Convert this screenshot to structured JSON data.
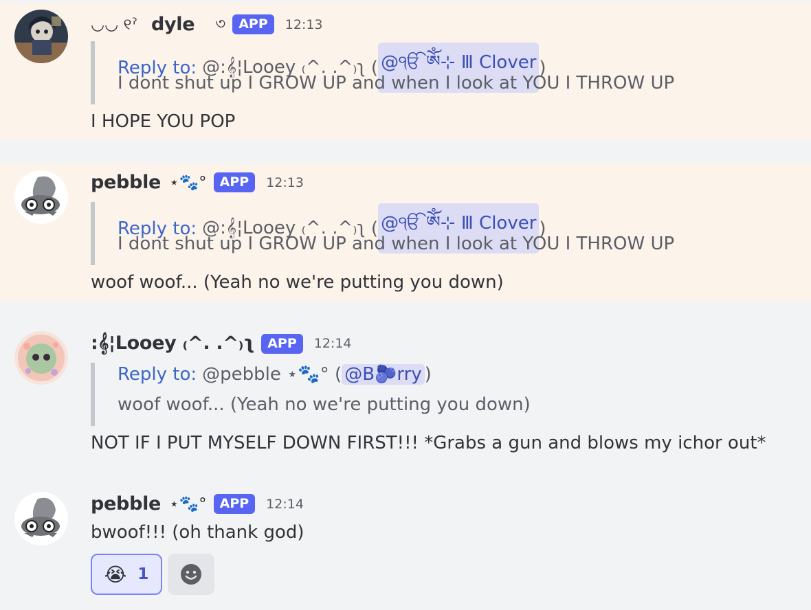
{
  "messages": [
    {
      "username": "dyle",
      "prefix_deco": "◡◡   ୧ˀ",
      "suffix_deco": "৩",
      "badge": "APP",
      "time": "12:13",
      "reply_label": "Reply to:",
      "reply_author": "@:𝄞¦Looey ₍^. .^₎ʅ",
      "reply_ping": "@ੴ ༀ⊹        Ⅲ        Clover",
      "reply_text": "I dont shut up I GROW UP and when I look at YOU I THROW UP",
      "text": "I HOPE YOU POP"
    },
    {
      "username": "pebble",
      "suffix_deco": "⋆🐾°",
      "badge": "APP",
      "time": "12:13",
      "reply_label": "Reply to:",
      "reply_author": "@:𝄞¦Looey ₍^. .^₎ʅ",
      "reply_ping": "@ੴ ༀ⊹        Ⅲ        Clover",
      "reply_text": "I dont shut up I GROW UP and when I look at YOU I THROW UP",
      "text": "woof woof... (Yeah no we're putting you down)"
    },
    {
      "username": ":𝄞¦Looey ₍^. .^₎ʅ",
      "badge": "APP",
      "time": "12:14",
      "reply_label": "Reply to:",
      "reply_author": "@pebble ⋆🐾°",
      "reply_ping": "@B🫐rry",
      "reply_text": "woof woof... (Yeah no we're putting you down)",
      "text": "NOT IF I PUT MYSELF DOWN FIRST!!! *Grabs a gun and blows my ichor out*"
    },
    {
      "username": "pebble",
      "suffix_deco": "⋆🐾°",
      "badge": "APP",
      "time": "12:14",
      "text": "bwoof!!! (oh thank god)",
      "reactions": [
        {
          "emoji": "😭",
          "count": "1",
          "active": true
        }
      ],
      "add_reaction_icon": "smiley-add-reaction-icon"
    }
  ],
  "colors": {
    "mention_bg": "#fcf3ea",
    "app_badge": "#5865f2",
    "reply_link": "#3b66c9",
    "ping_bg": "#dcdcf4"
  }
}
